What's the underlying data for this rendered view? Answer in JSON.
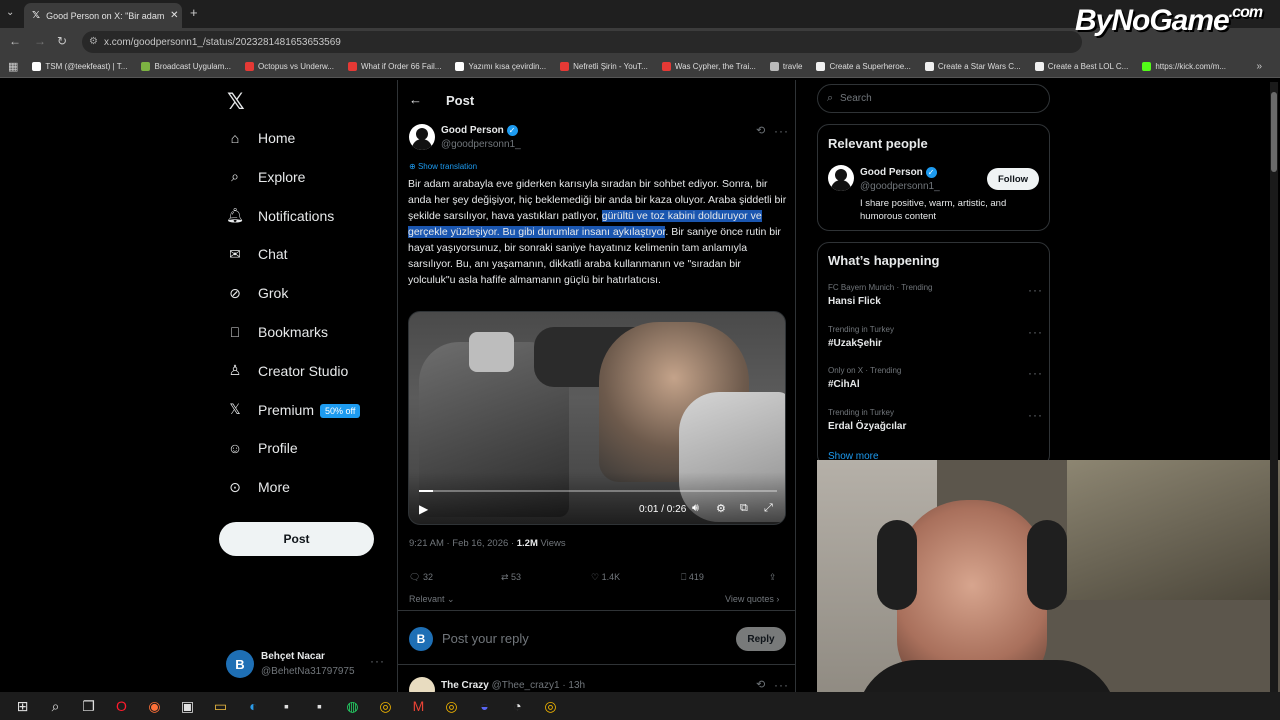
{
  "browser": {
    "tab_title": "Good Person on X: \"Bir adam a",
    "url": "x.com/goodpersonn1_/status/2023281481653653569",
    "bookmarks": [
      {
        "label": "TSM (@teekfeast) | T...",
        "color": "#ffffff"
      },
      {
        "label": "Broadcast Uygulam...",
        "color": "#7cb342"
      },
      {
        "label": "Octopus vs Underw...",
        "color": "#e53935"
      },
      {
        "label": "What if Order 66 Fail...",
        "color": "#e53935"
      },
      {
        "label": "Yazımı kısa çevirdin...",
        "color": "#ffffff"
      },
      {
        "label": "Nefretli Şirin - YouT...",
        "color": "#e53935"
      },
      {
        "label": "Was Cypher, the Trai...",
        "color": "#e53935"
      },
      {
        "label": "travle",
        "color": "#bbbbbb"
      },
      {
        "label": "Create a Superheroe...",
        "color": "#f0f0f0"
      },
      {
        "label": "Create a Star Wars C...",
        "color": "#f0f0f0"
      },
      {
        "label": "Create a Best LOL C...",
        "color": "#f0f0f0"
      },
      {
        "label": "https://kick.com/m...",
        "color": "#53fc18"
      }
    ]
  },
  "watermark": "ByNoGame",
  "watermark_sub": ".com",
  "nav": {
    "items": [
      {
        "label": "Home",
        "icon": "home-icon"
      },
      {
        "label": "Explore",
        "icon": "search-icon"
      },
      {
        "label": "Notifications",
        "icon": "bell-icon"
      },
      {
        "label": "Chat",
        "icon": "mail-icon"
      },
      {
        "label": "Grok",
        "icon": "grok-icon"
      },
      {
        "label": "Bookmarks",
        "icon": "bookmark-icon"
      },
      {
        "label": "Creator Studio",
        "icon": "creator-icon"
      },
      {
        "label": "Premium",
        "icon": "x-icon"
      },
      {
        "label": "Profile",
        "icon": "person-icon"
      },
      {
        "label": "More",
        "icon": "more-icon"
      }
    ],
    "premium_badge": "50% off",
    "post_button": "Post",
    "account": {
      "avatar_letter": "B",
      "name": "Behçet Nacar",
      "handle": "@BehetNa31797975"
    }
  },
  "post": {
    "header_title": "Post",
    "author_name": "Good Person",
    "author_handle": "@goodpersonn1_",
    "show_translation": "Show translation",
    "text_before": "Bir adam arabayla eve giderken karısıyla sıradan bir sohbet ediyor. Sonra, bir anda her şey değişiyor, hiç beklemediği bir anda bir kaza oluyor. Araba şiddetli bir şekilde sarsılıyor, hava yastıkları patlıyor, ",
    "text_highlight": "gürültü ve toz kabini dolduruyor ve gerçekle yüzleşiyor. Bu gibi durumlar insanı aykılaştıyor",
    "text_after": ". Bir saniye önce rutin bir hayat yaşıyorsunuz, bir sonraki saniye hayatınız kelimenin tam anlamıyla sarsılıyor. Bu, anı yaşamanın, dikkatli araba kullanmanın ve \"sıradan bir yolculuk\"u asla hafife almamanın güçlü bir hatırlatıcısı.",
    "video": {
      "time": "0:01 / 0:26",
      "progress": 0.04
    },
    "timestamp": "9:21 AM · Feb 16, 2026 · ",
    "views_count": "1.2M",
    "views_label": " Views",
    "stats": {
      "replies": "32",
      "reposts": "53",
      "likes": "1.4K",
      "bookmarks": "419"
    },
    "relevant_label": "Relevant",
    "view_quotes": "View quotes",
    "reply_placeholder": "Post your reply",
    "reply_button": "Reply",
    "next_reply": {
      "name": "The Crazy",
      "handle": "@Thee_crazy1",
      "time": "· 13h"
    }
  },
  "sidebar": {
    "search_placeholder": "Search",
    "relevant_title": "Relevant people",
    "person": {
      "name": "Good Person",
      "handle": "@goodpersonn1_",
      "bio": "I share positive, warm, artistic, and humorous content",
      "follow": "Follow"
    },
    "happening_title": "What’s happening",
    "trends": [
      {
        "meta": "FC Bayern Munich · Trending",
        "name": "Hansi Flick"
      },
      {
        "meta": "Trending in Turkey",
        "name": "#UzakŞehir"
      },
      {
        "meta": "Only on X · Trending",
        "name": "#CihAl"
      },
      {
        "meta": "Trending in Turkey",
        "name": "Erdal Özyağcılar"
      }
    ],
    "show_more": "Show more"
  },
  "taskbar": {
    "icons": [
      "windows-icon",
      "search-icon",
      "taskview-icon",
      "opera-icon",
      "firefox-icon",
      "store-icon",
      "explorer-icon",
      "edge-icon",
      "app-icon",
      "app-icon",
      "whatsapp-icon",
      "chrome-icon",
      "gmail-icon",
      "chrome-icon",
      "discord-icon",
      "obs-icon",
      "chrome-icon"
    ]
  }
}
